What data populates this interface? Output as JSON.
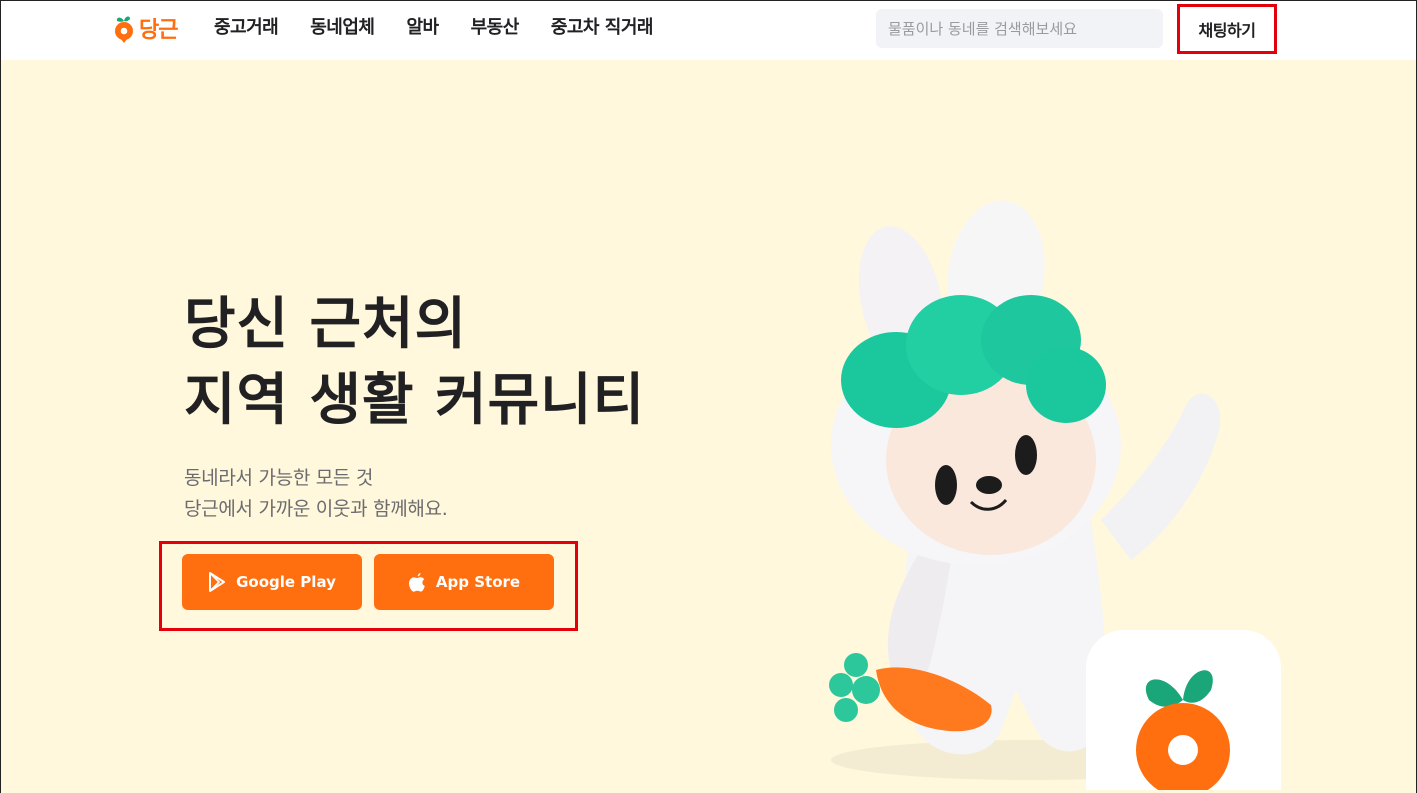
{
  "header": {
    "logo_text": "당근",
    "nav": [
      "중고거래",
      "동네업체",
      "알바",
      "부동산",
      "중고차 직거래"
    ],
    "search_placeholder": "물품이나 동네를 검색해보세요",
    "chat_label": "채팅하기"
  },
  "hero": {
    "headline_line1": "당신 근처의",
    "headline_line2": "지역 생활 커뮤니티",
    "sub_line1": "동네라서 가능한 모든 것",
    "sub_line2": "당근에서 가까운 이웃과 함께해요.",
    "google_play_label": "Google Play",
    "app_store_label": "App Store"
  },
  "colors": {
    "brand": "#ff6f0f",
    "hero_bg": "#fff8dc",
    "highlight": "#e3000b",
    "mascot_hair": "#1bc89e"
  },
  "icons": [
    "carrot-logo-icon",
    "google-play-icon",
    "apple-icon",
    "carrot-app-icon"
  ]
}
